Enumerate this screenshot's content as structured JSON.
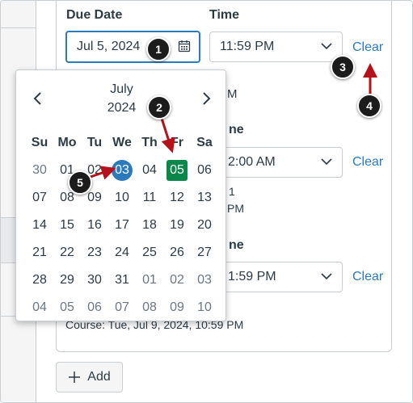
{
  "due": {
    "date_label": "Due Date",
    "time_label": "Time",
    "date_value": "Jul 5, 2024",
    "time_value": "11:59 PM",
    "clear_label": "Clear",
    "partial_below": "M"
  },
  "avail_from": {
    "time_label_partial": "ne",
    "time_value_partial": "2:00 AM",
    "clear_label": "Clear",
    "note_line1_partial": "1",
    "note_line2_partial": "PM"
  },
  "until": {
    "time_label_partial": "ne",
    "time_value_partial": "1:59 PM",
    "clear_label": "Clear",
    "footer_note": "Course: Tue, Jul 9, 2024, 10:59 PM"
  },
  "add_button_label": "Add",
  "calendar": {
    "month": "July",
    "year": "2024",
    "weekdays": [
      "Su",
      "Mo",
      "Tu",
      "We",
      "Th",
      "Fr",
      "Sa"
    ],
    "weeks": [
      [
        {
          "d": "30",
          "out": true
        },
        {
          "d": "01"
        },
        {
          "d": "02"
        },
        {
          "d": "03",
          "today": true
        },
        {
          "d": "04"
        },
        {
          "d": "05",
          "selected": true
        },
        {
          "d": "06"
        }
      ],
      [
        {
          "d": "07"
        },
        {
          "d": "08"
        },
        {
          "d": "09"
        },
        {
          "d": "10"
        },
        {
          "d": "11"
        },
        {
          "d": "12"
        },
        {
          "d": "13"
        }
      ],
      [
        {
          "d": "14"
        },
        {
          "d": "15"
        },
        {
          "d": "16"
        },
        {
          "d": "17"
        },
        {
          "d": "18"
        },
        {
          "d": "19"
        },
        {
          "d": "20"
        }
      ],
      [
        {
          "d": "21"
        },
        {
          "d": "22"
        },
        {
          "d": "23"
        },
        {
          "d": "24"
        },
        {
          "d": "25"
        },
        {
          "d": "26"
        },
        {
          "d": "27"
        }
      ],
      [
        {
          "d": "28"
        },
        {
          "d": "29"
        },
        {
          "d": "30"
        },
        {
          "d": "31"
        },
        {
          "d": "01",
          "out": true
        },
        {
          "d": "02",
          "out": true
        },
        {
          "d": "03",
          "out": true
        }
      ],
      [
        {
          "d": "04",
          "out": true
        },
        {
          "d": "05",
          "out": true
        },
        {
          "d": "06",
          "out": true
        },
        {
          "d": "07",
          "out": true
        },
        {
          "d": "08",
          "out": true
        },
        {
          "d": "09",
          "out": true
        },
        {
          "d": "10",
          "out": true
        }
      ]
    ],
    "prev_icon": "chevron-left-icon",
    "next_icon": "chevron-right-icon"
  },
  "markers": [
    "1",
    "2",
    "3",
    "4",
    "5"
  ],
  "colors": {
    "accent_blue": "#2b7abc",
    "selected_green": "#0b874b",
    "arrow_red": "#b5121b",
    "marker_black": "#1c1c1c"
  }
}
